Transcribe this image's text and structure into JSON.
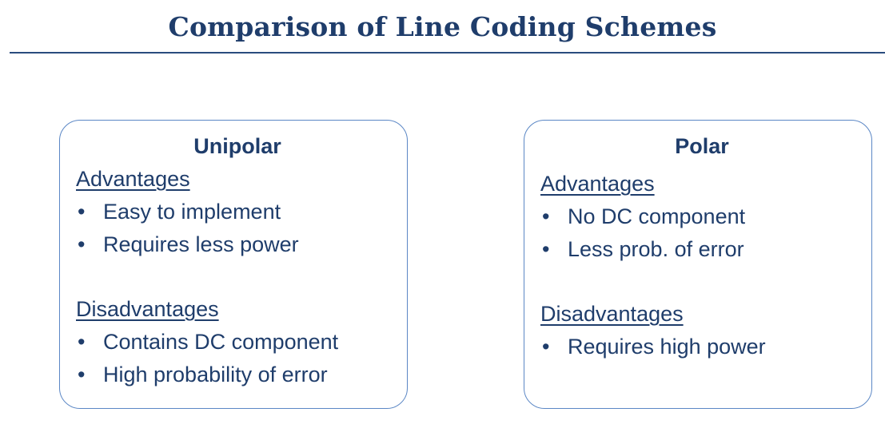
{
  "title": "Comparison of Line Coding Schemes",
  "cards": [
    {
      "heading": "Unipolar",
      "advantages_label": "Advantages",
      "advantages": [
        "Easy to implement",
        "Requires less power"
      ],
      "disadvantages_label": "Disadvantages",
      "disadvantages": [
        "Contains DC component",
        "High probability of error"
      ]
    },
    {
      "heading": "Polar",
      "advantages_label": "Advantages",
      "advantages": [
        "No DC component",
        "Less prob. of error"
      ],
      "disadvantages_label": "Disadvantages",
      "disadvantages": [
        "Requires high power"
      ]
    }
  ],
  "colors": {
    "text": "#1f3d6b",
    "card_border": "#5b87c5",
    "rule": "#2a4c7e"
  }
}
